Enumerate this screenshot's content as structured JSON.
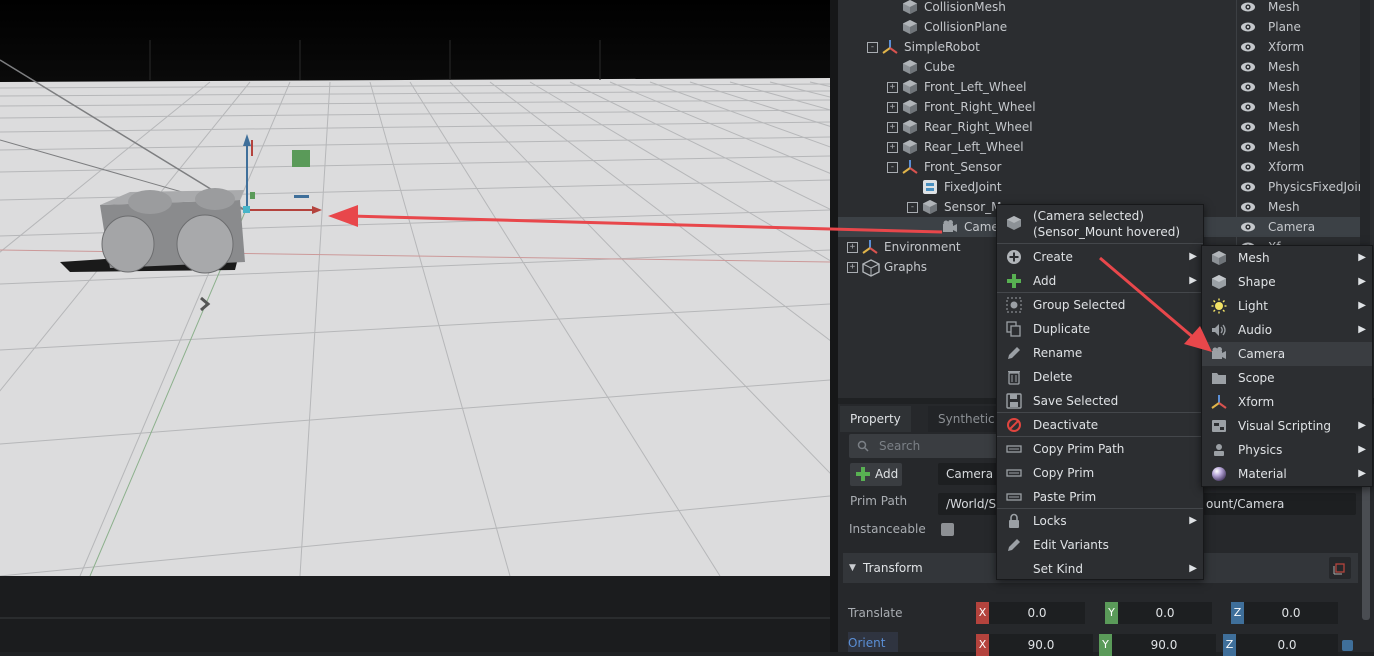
{
  "stage": {
    "rows": [
      {
        "name": "CollisionMesh",
        "type": "Mesh"
      },
      {
        "name": "CollisionPlane",
        "type": "Plane"
      },
      {
        "name": "SimpleRobot",
        "type": "Xform"
      },
      {
        "name": "Cube",
        "type": "Mesh"
      },
      {
        "name": "Front_Left_Wheel",
        "type": "Mesh"
      },
      {
        "name": "Front_Right_Wheel",
        "type": "Mesh"
      },
      {
        "name": "Rear_Right_Wheel",
        "type": "Mesh"
      },
      {
        "name": "Rear_Left_Wheel",
        "type": "Mesh"
      },
      {
        "name": "Front_Sensor",
        "type": "Xform"
      },
      {
        "name": "FixedJoint",
        "type": "PhysicsFixedJoin"
      },
      {
        "name": "Sensor_M",
        "type": "Mesh"
      },
      {
        "name": "Came",
        "type": "Camera"
      },
      {
        "name": "Environment",
        "type": "Xf"
      },
      {
        "name": "Graphs",
        "type": ""
      }
    ]
  },
  "context_menu": {
    "header_line1": "(Camera selected)",
    "header_line2": "(Sensor_Mount hovered)",
    "items": [
      {
        "label": "Create",
        "icon": "plus-circle-icon",
        "submenu": true
      },
      {
        "label": "Add",
        "icon": "green-plus-icon",
        "submenu": true
      },
      {
        "label": "Group Selected",
        "icon": "group-icon",
        "submenu": false
      },
      {
        "label": "Duplicate",
        "icon": "duplicate-icon",
        "submenu": false
      },
      {
        "label": "Rename",
        "icon": "pencil-icon",
        "submenu": false
      },
      {
        "label": "Delete",
        "icon": "trash-icon",
        "submenu": false
      },
      {
        "label": "Save Selected",
        "icon": "save-icon",
        "submenu": false
      },
      {
        "label": "Deactivate",
        "icon": "deactivate-icon",
        "submenu": false
      },
      {
        "label": "Copy Prim Path",
        "icon": "copy-path-icon",
        "submenu": false
      },
      {
        "label": "Copy Prim",
        "icon": "copy-prim-icon",
        "submenu": false
      },
      {
        "label": "Paste Prim",
        "icon": "paste-prim-icon",
        "submenu": false
      },
      {
        "label": "Locks",
        "icon": "lock-icon",
        "submenu": true
      },
      {
        "label": "Edit Variants",
        "icon": "edit-variants-icon",
        "submenu": false
      },
      {
        "label": "Set Kind",
        "icon": "",
        "submenu": true
      }
    ]
  },
  "submenu": {
    "items": [
      {
        "label": "Mesh",
        "icon": "mesh-cube-icon",
        "submenu": true
      },
      {
        "label": "Shape",
        "icon": "shape-cube-icon",
        "submenu": true
      },
      {
        "label": "Light",
        "icon": "light-icon",
        "submenu": true
      },
      {
        "label": "Audio",
        "icon": "speaker-icon",
        "submenu": true
      },
      {
        "label": "Camera",
        "icon": "camera-icon",
        "submenu": false
      },
      {
        "label": "Scope",
        "icon": "folder-icon",
        "submenu": false
      },
      {
        "label": "Xform",
        "icon": "xform-axes-icon",
        "submenu": false
      },
      {
        "label": "Visual Scripting",
        "icon": "visual-scripting-icon",
        "submenu": true
      },
      {
        "label": "Physics",
        "icon": "physics-icon",
        "submenu": true
      },
      {
        "label": "Material",
        "icon": "material-sphere-icon",
        "submenu": true
      }
    ]
  },
  "property": {
    "tab_property": "Property",
    "tab_synthetic": "Synthetic D",
    "search_placeholder": "Search",
    "add_label": "Add",
    "type_value": "Camera",
    "prim_path_label": "Prim Path",
    "prim_path_value_left": "/World/S",
    "prim_path_value_right": "ount/Camera",
    "instanceable_label": "Instanceable",
    "transform_label": "Transform",
    "translate_label": "Translate",
    "translate": {
      "x": "0.0",
      "y": "0.0",
      "z": "0.0"
    },
    "orient_label": "Orient",
    "orient": {
      "x": "90.0",
      "y": "90.0",
      "z": "0.0"
    }
  },
  "colors": {
    "axis_x": "#b4433d",
    "axis_y": "#5a9a59",
    "axis_z": "#3f6f9a",
    "annotation_arrow": "#e8474b"
  }
}
